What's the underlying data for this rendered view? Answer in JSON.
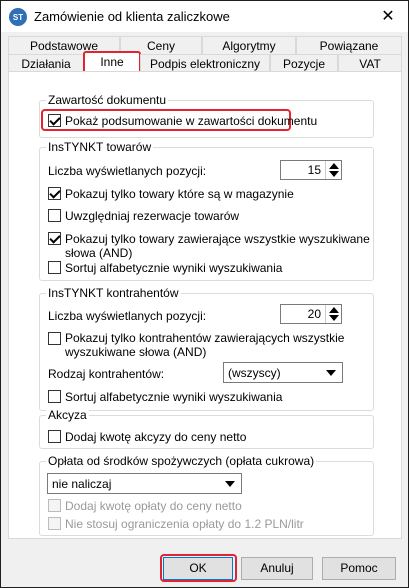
{
  "window": {
    "title": "Zamówienie od klienta zaliczkowe",
    "icon_text": "ST",
    "close_glyph": "✕"
  },
  "tabs_row1": [
    "Podstawowe",
    "Ceny",
    "Algorytmy",
    "Powiązane"
  ],
  "tabs_row2": [
    "Działania",
    "Inne",
    "Podpis elektroniczny",
    "Pozycje",
    "VAT"
  ],
  "active_tab": "Inne",
  "doc_content": {
    "title": "Zawartość dokumentu",
    "show_summary": {
      "label": "Pokaż podsumowanie w zawartości dokumentu",
      "checked": true
    }
  },
  "instynkt_goods": {
    "title": "InsTYNKT towarów",
    "count_label": "Liczba wyświetlanych pozycji:",
    "count_value": "15",
    "options": [
      {
        "label": "Pokazuj tylko towary które są w magazynie",
        "checked": true
      },
      {
        "label": "Uwzględniaj rezerwacje towarów",
        "checked": false
      },
      {
        "label": "Pokazuj tylko towary zawierające wszystkie wyszukiwane",
        "label2": "słowa (AND)",
        "checked": true
      },
      {
        "label": "Sortuj alfabetycznie wyniki wyszukiwania",
        "checked": false
      }
    ]
  },
  "instynkt_contractors": {
    "title": "InsTYNKT kontrahentów",
    "count_label": "Liczba wyświetlanych pozycji:",
    "count_value": "20",
    "option_and": {
      "label": "Pokazuj tylko kontrahentów zawierających wszystkie",
      "label2": "wyszukiwane słowa (AND)",
      "checked": false
    },
    "type_label": "Rodzaj kontrahentów:",
    "type_value": "(wszyscy)",
    "sort": {
      "label": "Sortuj alfabetycznie wyniki wyszukiwania",
      "checked": false
    }
  },
  "excise": {
    "title": "Akcyza",
    "add": {
      "label": "Dodaj kwotę akcyzy do ceny netto",
      "checked": false
    }
  },
  "sugar_fee": {
    "title": "Opłata od środków spożywczych (opłata cukrowa)",
    "mode_value": "nie naliczaj",
    "add": {
      "label": "Dodaj kwotę opłaty do ceny netto",
      "checked": false
    },
    "no_limit": {
      "label": "Nie stosuj ograniczenia opłaty do 1.2 PLN/litr",
      "checked": false
    }
  },
  "buttons": {
    "ok": "OK",
    "cancel": "Anuluj",
    "help": "Pomoc"
  },
  "colors": {
    "highlight": "#e0252e",
    "accent": "#0078d7"
  }
}
